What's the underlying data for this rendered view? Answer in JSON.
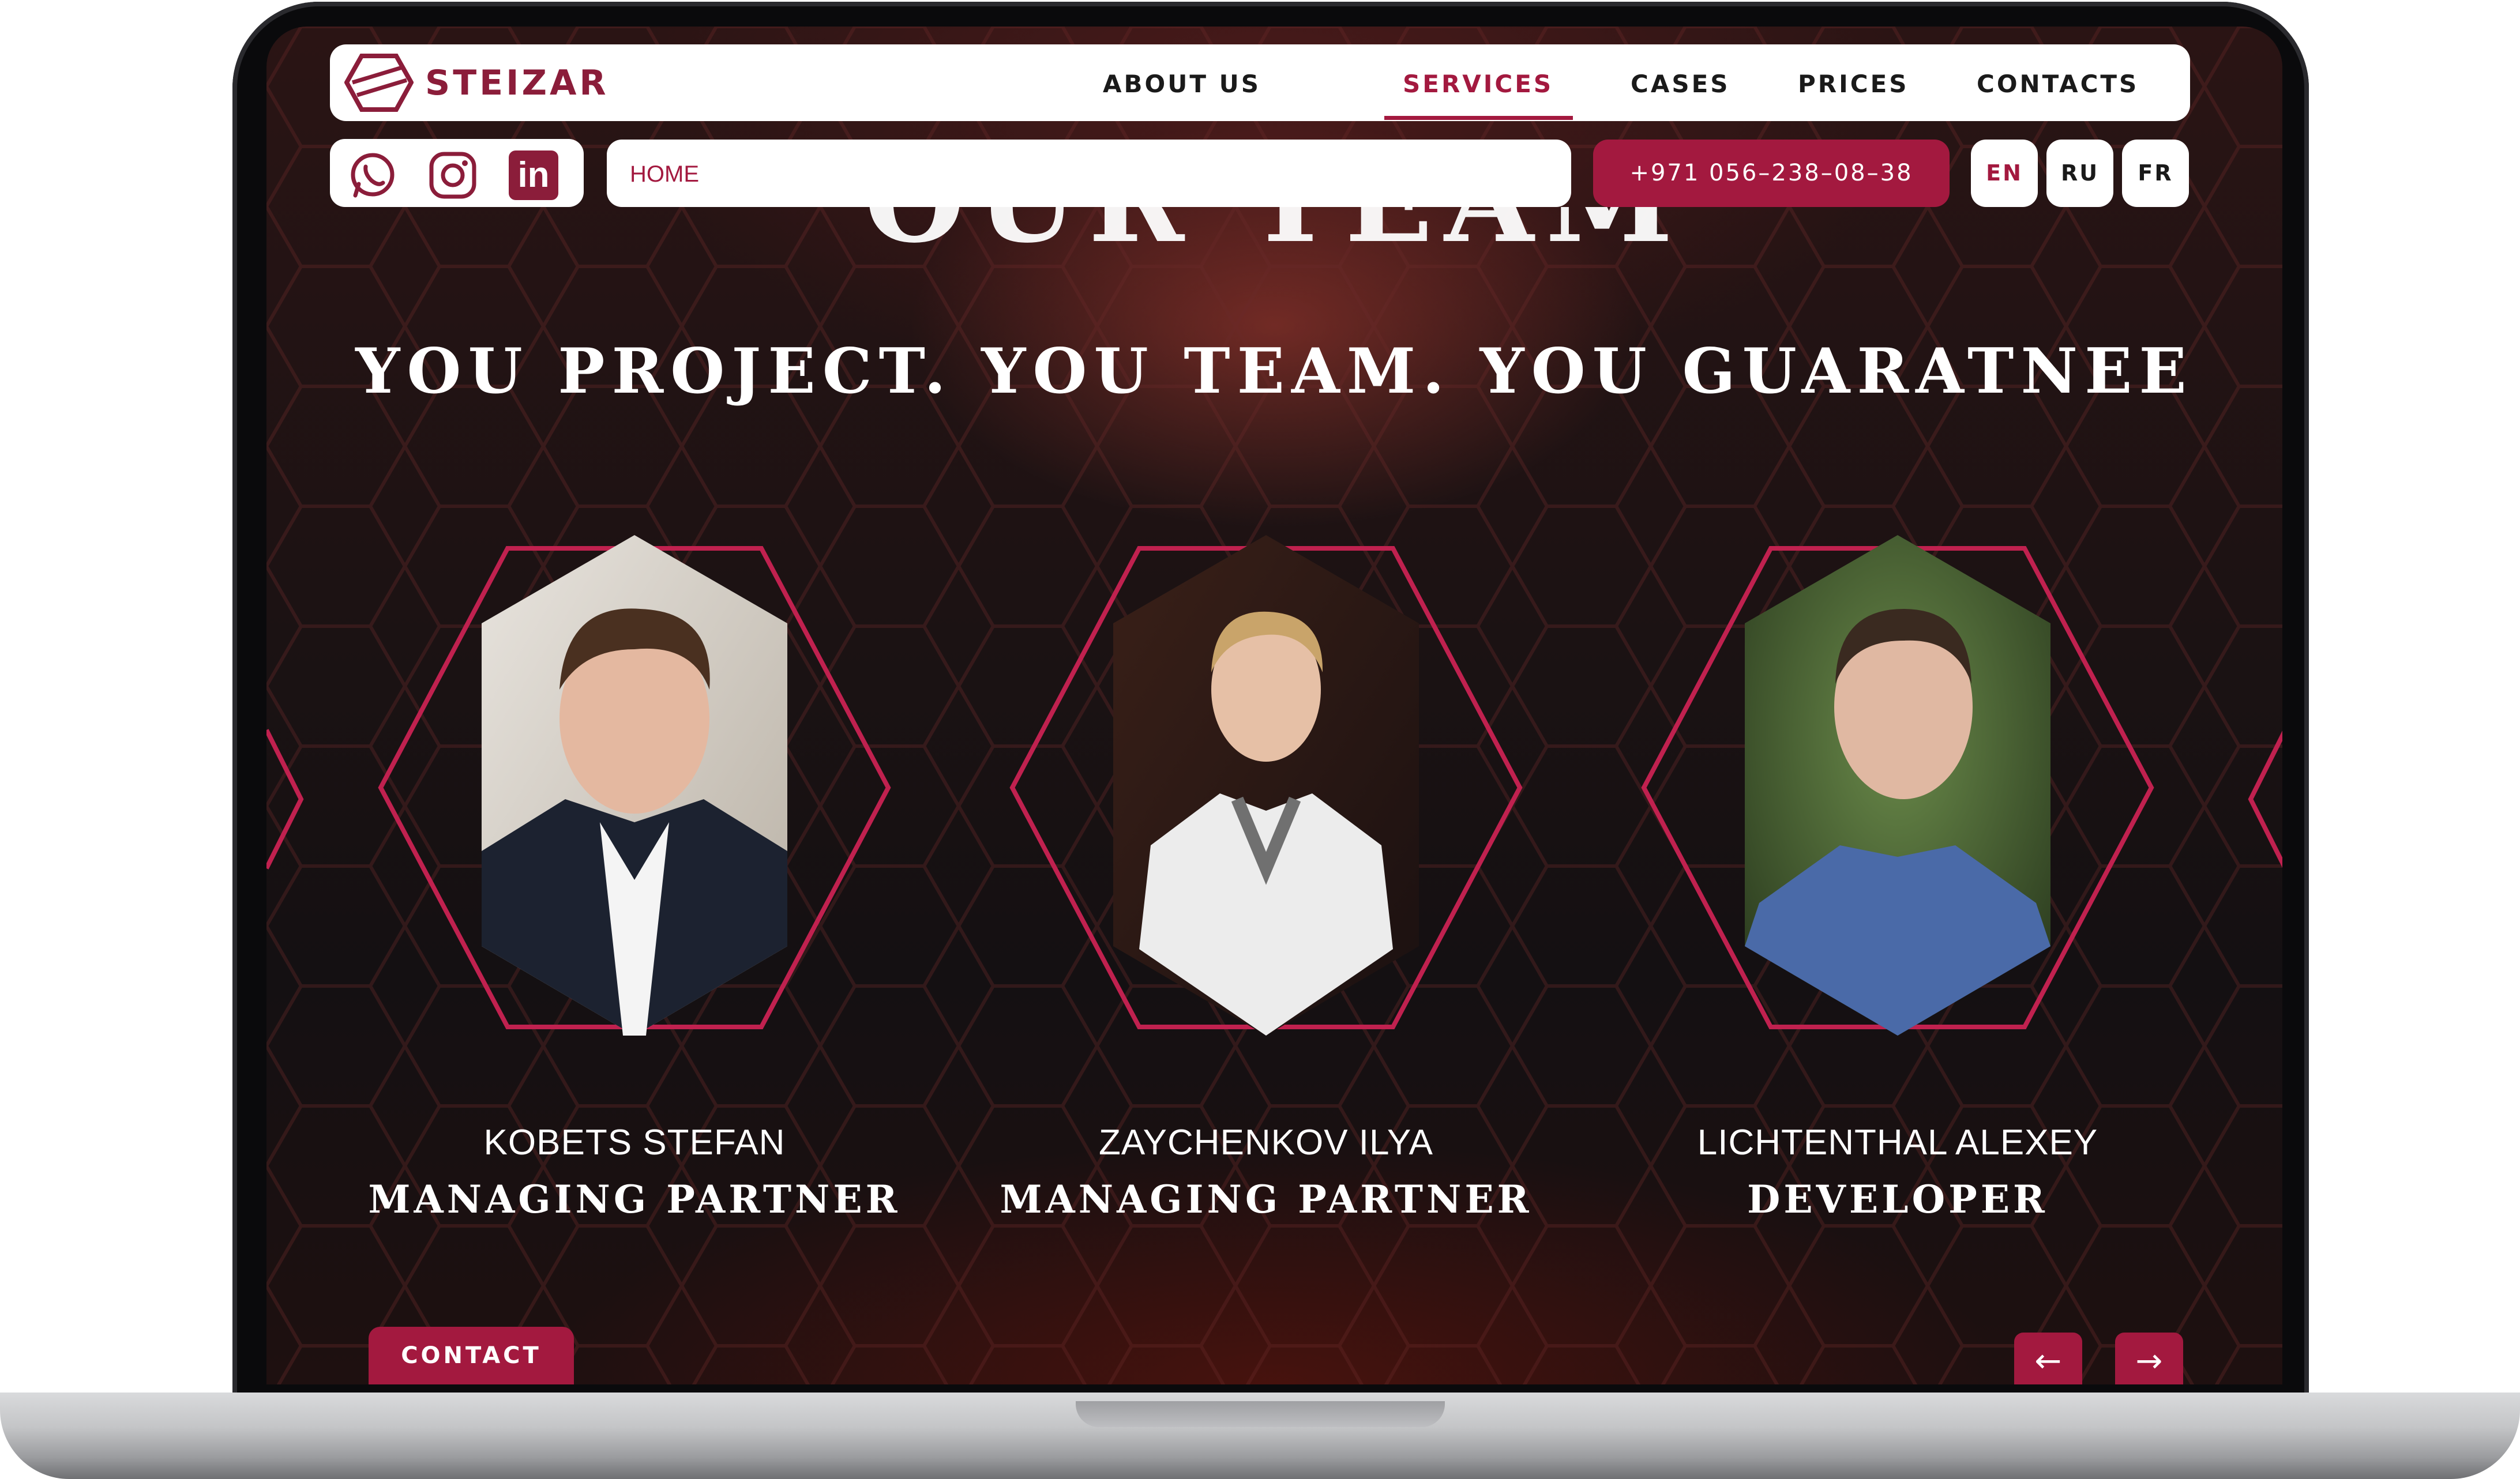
{
  "header": {
    "brand": "STEIZAR",
    "nav": [
      {
        "label": "ABOUT US",
        "active": false
      },
      {
        "label": "SERVICES",
        "active": true
      },
      {
        "label": "CASES",
        "active": false
      },
      {
        "label": "PRICES",
        "active": false
      },
      {
        "label": "CONTACTS",
        "active": false
      }
    ]
  },
  "social": {
    "icons": [
      "whatsapp-icon",
      "instagram-icon",
      "linkedin-icon"
    ],
    "linkedin_text": "in"
  },
  "breadcrumb": {
    "text": "HOME"
  },
  "phone": {
    "label": "+971 056–238–08–38"
  },
  "languages": [
    {
      "label": "EN",
      "active": true
    },
    {
      "label": "RU",
      "active": false
    },
    {
      "label": "FR",
      "active": false
    }
  ],
  "section": {
    "ghost_title": "OUR TEAM",
    "headline": "YOU PROJECT. YOU TEAM. YOU GUARATNEE"
  },
  "team": [
    {
      "name": "KOBETS STEFAN",
      "role": "MANAGING PARTNER"
    },
    {
      "name": "ZAYCHENKOV ILYA",
      "role": "MANAGING PARTNER"
    },
    {
      "name": "LICHTENTHAL ALEXEY",
      "role": "DEVELOPER"
    }
  ],
  "footer": {
    "contact_label": "CONTACT",
    "prev_icon": "arrow-left-icon",
    "next_icon": "arrow-right-icon",
    "prev_glyph": "←",
    "next_glyph": "→"
  },
  "colors": {
    "accent": "#a3193f",
    "brand": "#8b1d3a",
    "background_dark": "#1b1213",
    "white": "#ffffff"
  }
}
